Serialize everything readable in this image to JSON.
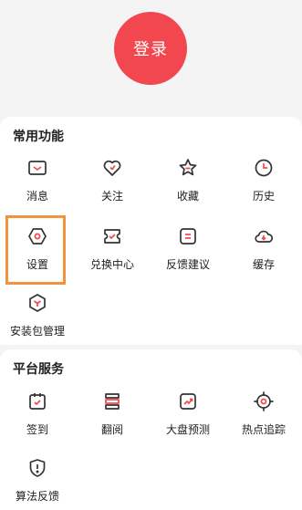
{
  "login": {
    "label": "登录"
  },
  "common": {
    "title": "常用功能",
    "items": [
      {
        "label": "消息",
        "icon": "message-icon"
      },
      {
        "label": "关注",
        "icon": "heart-icon"
      },
      {
        "label": "收藏",
        "icon": "star-icon"
      },
      {
        "label": "历史",
        "icon": "clock-icon"
      },
      {
        "label": "设置",
        "icon": "gear-icon"
      },
      {
        "label": "兑换中心",
        "icon": "ticket-icon"
      },
      {
        "label": "反馈建议",
        "icon": "feedback-icon"
      },
      {
        "label": "缓存",
        "icon": "cloud-download-icon"
      },
      {
        "label": "安装包管理",
        "icon": "package-icon"
      }
    ]
  },
  "platform": {
    "title": "平台服务",
    "items": [
      {
        "label": "签到",
        "icon": "checkin-icon"
      },
      {
        "label": "翻阅",
        "icon": "book-icon"
      },
      {
        "label": "大盘预测",
        "icon": "trend-icon"
      },
      {
        "label": "热点追踪",
        "icon": "target-icon"
      },
      {
        "label": "算法反馈",
        "icon": "shield-alert-icon"
      }
    ]
  },
  "colors": {
    "accent": "#f2474e",
    "highlight": "#f5923e",
    "icon_stroke": "#333333"
  }
}
